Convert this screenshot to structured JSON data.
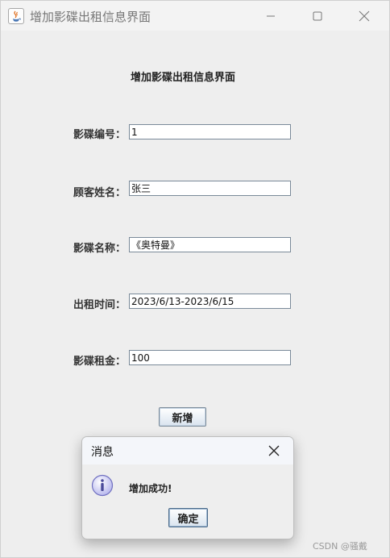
{
  "window": {
    "title": "增加影碟出租信息界面",
    "controls": [
      "minimize-icon",
      "maximize-icon",
      "close-icon"
    ]
  },
  "form": {
    "heading": "增加影碟出租信息界面",
    "fields": [
      {
        "label": "影碟编号：",
        "value": "1"
      },
      {
        "label": "顾客姓名：",
        "value": "张三"
      },
      {
        "label": "影碟名称：",
        "value": "《奥特曼》"
      },
      {
        "label": "出租时间：",
        "value": "2023/6/13-2023/6/15"
      },
      {
        "label": "影碟租金：",
        "value": "100"
      }
    ],
    "add_button": "新增"
  },
  "dialog": {
    "title": "消息",
    "message": "增加成功!",
    "ok_button": "确定",
    "icon": "info-icon"
  },
  "watermark": "CSDN @骚戴",
  "colors": {
    "field_border": "#7a8a99",
    "info_icon": "#8b8bd0"
  }
}
